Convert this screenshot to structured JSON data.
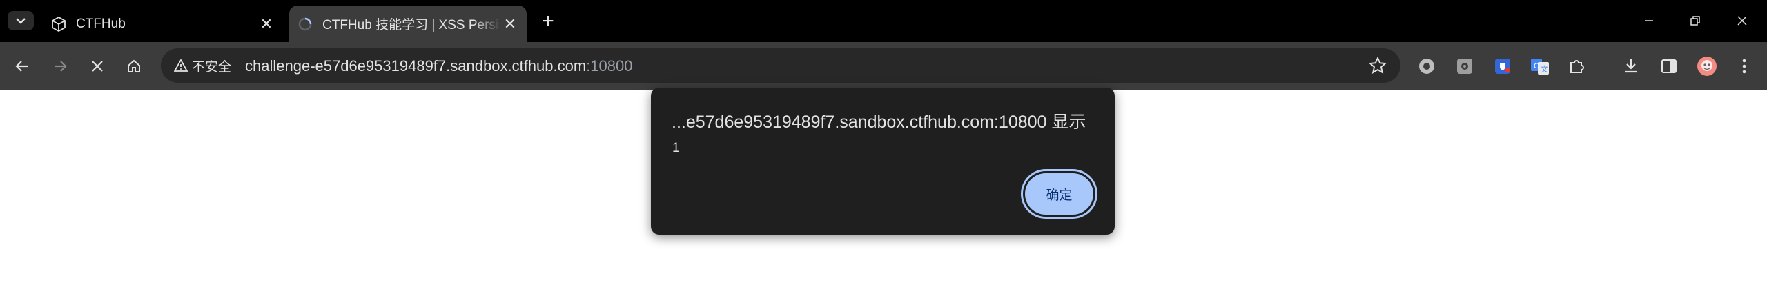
{
  "tabs": [
    {
      "title": "CTFHub",
      "favicon": "ctfhub-cube-icon",
      "active": false
    },
    {
      "title": "CTFHub 技能学习 | XSS Persistent",
      "favicon": "loading-spinner-icon",
      "active": true
    }
  ],
  "toolbar": {
    "security_label": "不安全",
    "url_host": "challenge-e57d6e95319489f7.sandbox.ctfhub.com",
    "url_port": ":10800"
  },
  "dialog": {
    "title": "...e57d6e95319489f7.sandbox.ctfhub.com:10800 显示",
    "message": "1",
    "ok_label": "确定"
  },
  "colors": {
    "tabstrip_bg": "#000000",
    "toolbar_bg": "#3c3c3c",
    "omnibox_bg": "#282828",
    "dialog_bg": "#1f1f1f",
    "accent": "#a8c7fa"
  }
}
